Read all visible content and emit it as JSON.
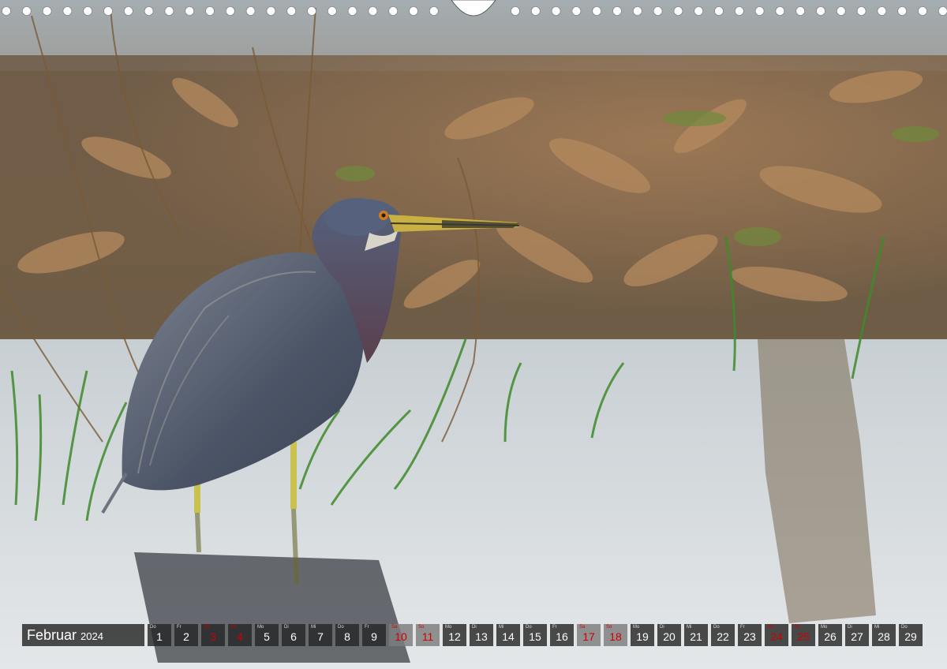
{
  "calendar": {
    "month": "Februar",
    "year": "2024",
    "days": [
      {
        "wd": "Do",
        "d": "1",
        "type": "work"
      },
      {
        "wd": "Fr",
        "d": "2",
        "type": "work"
      },
      {
        "wd": "Sa",
        "d": "3",
        "type": "hol"
      },
      {
        "wd": "So",
        "d": "4",
        "type": "hol"
      },
      {
        "wd": "Mo",
        "d": "5",
        "type": "work"
      },
      {
        "wd": "Di",
        "d": "6",
        "type": "work"
      },
      {
        "wd": "Mi",
        "d": "7",
        "type": "work"
      },
      {
        "wd": "Do",
        "d": "8",
        "type": "work"
      },
      {
        "wd": "Fr",
        "d": "9",
        "type": "work"
      },
      {
        "wd": "Sa",
        "d": "10",
        "type": "we"
      },
      {
        "wd": "So",
        "d": "11",
        "type": "we"
      },
      {
        "wd": "Mo",
        "d": "12",
        "type": "work"
      },
      {
        "wd": "Di",
        "d": "13",
        "type": "work"
      },
      {
        "wd": "Mi",
        "d": "14",
        "type": "work"
      },
      {
        "wd": "Do",
        "d": "15",
        "type": "work"
      },
      {
        "wd": "Fr",
        "d": "16",
        "type": "work"
      },
      {
        "wd": "Sa",
        "d": "17",
        "type": "we"
      },
      {
        "wd": "So",
        "d": "18",
        "type": "we"
      },
      {
        "wd": "Mo",
        "d": "19",
        "type": "work"
      },
      {
        "wd": "Di",
        "d": "20",
        "type": "work"
      },
      {
        "wd": "Mi",
        "d": "21",
        "type": "work"
      },
      {
        "wd": "Do",
        "d": "22",
        "type": "work"
      },
      {
        "wd": "Fr",
        "d": "23",
        "type": "work"
      },
      {
        "wd": "Sa",
        "d": "24",
        "type": "hol"
      },
      {
        "wd": "So",
        "d": "25",
        "type": "hol"
      },
      {
        "wd": "Mo",
        "d": "26",
        "type": "work"
      },
      {
        "wd": "Di",
        "d": "27",
        "type": "work"
      },
      {
        "wd": "Mi",
        "d": "28",
        "type": "work"
      },
      {
        "wd": "Do",
        "d": "29",
        "type": "work"
      }
    ]
  },
  "colors": {
    "holiday_text": "#d10000",
    "bar_dark": "#262626",
    "bar_weekend": "#7d7d7d"
  }
}
